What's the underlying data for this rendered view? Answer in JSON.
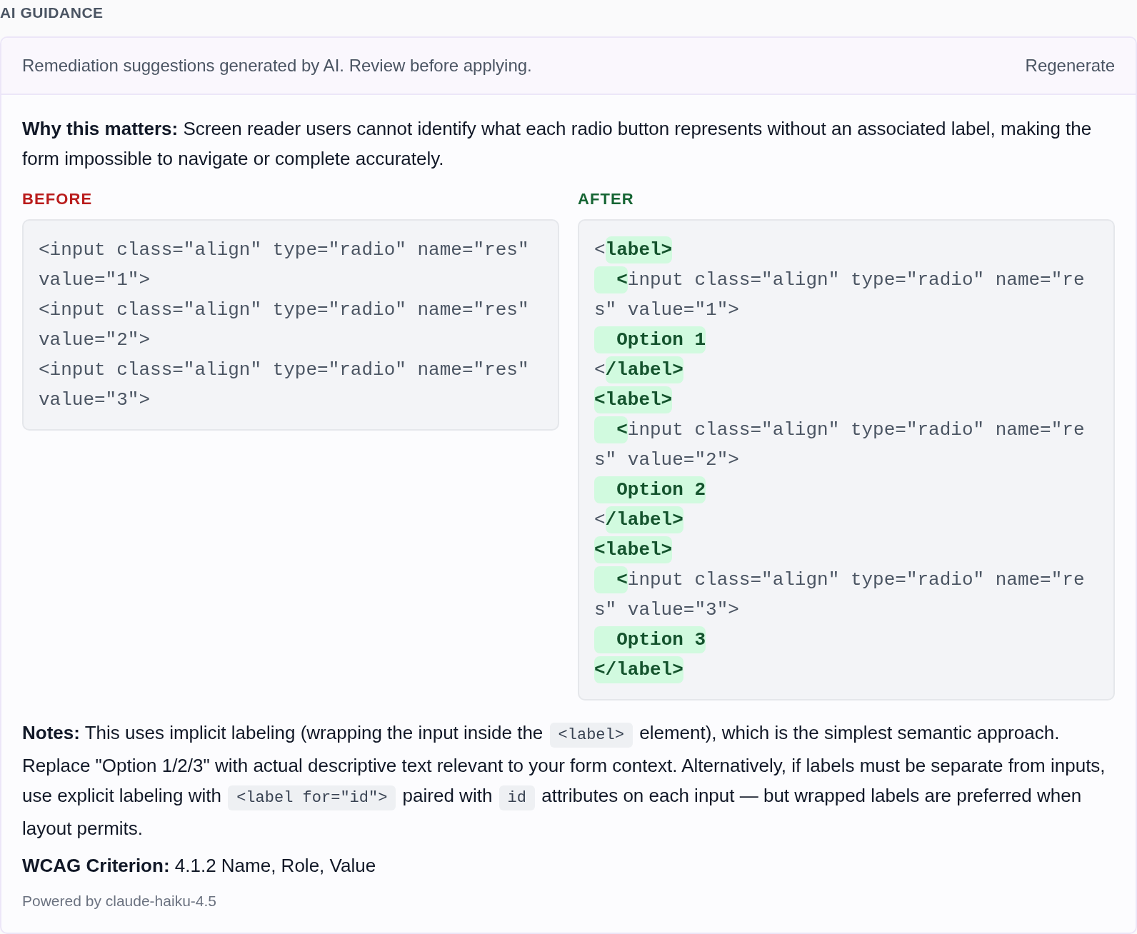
{
  "section_title": "AI GUIDANCE",
  "banner": {
    "text": "Remediation suggestions generated by AI. Review before applying.",
    "action": "Regenerate"
  },
  "why": "**Why this matters:** Screen reader users cannot identify what each radio button represents without an associated label, making the form impossible to navigate or complete accurately.",
  "before": {
    "label": "BEFORE",
    "lines": [
      "<input class=\"align\" type=\"radio\" name=\"res\" value=\"1\">",
      "<input class=\"align\" type=\"radio\" name=\"res\" value=\"2\">",
      "<input class=\"align\" type=\"radio\" name=\"res\" value=\"3\">"
    ]
  },
  "after": {
    "label": "AFTER",
    "lines": [
      [
        {
          "text": "<",
          "added": false
        },
        {
          "text": "label>",
          "added": true
        }
      ],
      [
        {
          "text": "  <",
          "added": true
        },
        {
          "text": "input class=\"align\" type=\"radio\" name=\"res\" value=\"1\">",
          "added": false
        }
      ],
      [
        {
          "text": "  Option 1",
          "added": true
        }
      ],
      [
        {
          "text": "<",
          "added": false
        },
        {
          "text": "/label>",
          "added": true
        }
      ],
      [
        {
          "text": "<label>",
          "added": true
        }
      ],
      [
        {
          "text": "  <",
          "added": true
        },
        {
          "text": "input class=\"align\" type=\"radio\" name=\"res\" value=\"2\">",
          "added": false
        }
      ],
      [
        {
          "text": "  Option 2",
          "added": true
        }
      ],
      [
        {
          "text": "<",
          "added": false
        },
        {
          "text": "/label>",
          "added": true
        }
      ],
      [
        {
          "text": "<label>",
          "added": true
        }
      ],
      [
        {
          "text": "  <",
          "added": true
        },
        {
          "text": "input class=\"align\" type=\"radio\" name=\"res\" value=\"3\">",
          "added": false
        }
      ],
      [
        {
          "text": "  Option 3",
          "added": true
        }
      ],
      [
        {
          "text": "</label>",
          "added": true
        }
      ]
    ]
  },
  "notes": [
    {
      "kind": "text",
      "text": "**Notes:** This uses implicit labeling (wrapping the input inside the "
    },
    {
      "kind": "code",
      "text": "<label>"
    },
    {
      "kind": "text",
      "text": " element), which is the simplest semantic approach. Replace \"Option 1/2/3\" with actual descriptive text relevant to your form context. Alternatively, if labels must be separate from inputs, use explicit labeling with "
    },
    {
      "kind": "code",
      "text": "<label for=\"id\">"
    },
    {
      "kind": "text",
      "text": " paired with "
    },
    {
      "kind": "code",
      "text": "id"
    },
    {
      "kind": "text",
      "text": " attributes on each input — but wrapped labels are preferred when layout permits."
    }
  ],
  "wcag": "**WCAG Criterion:** 4.1.2 Name, Role, Value",
  "footer": "Powered by claude-haiku-4.5"
}
